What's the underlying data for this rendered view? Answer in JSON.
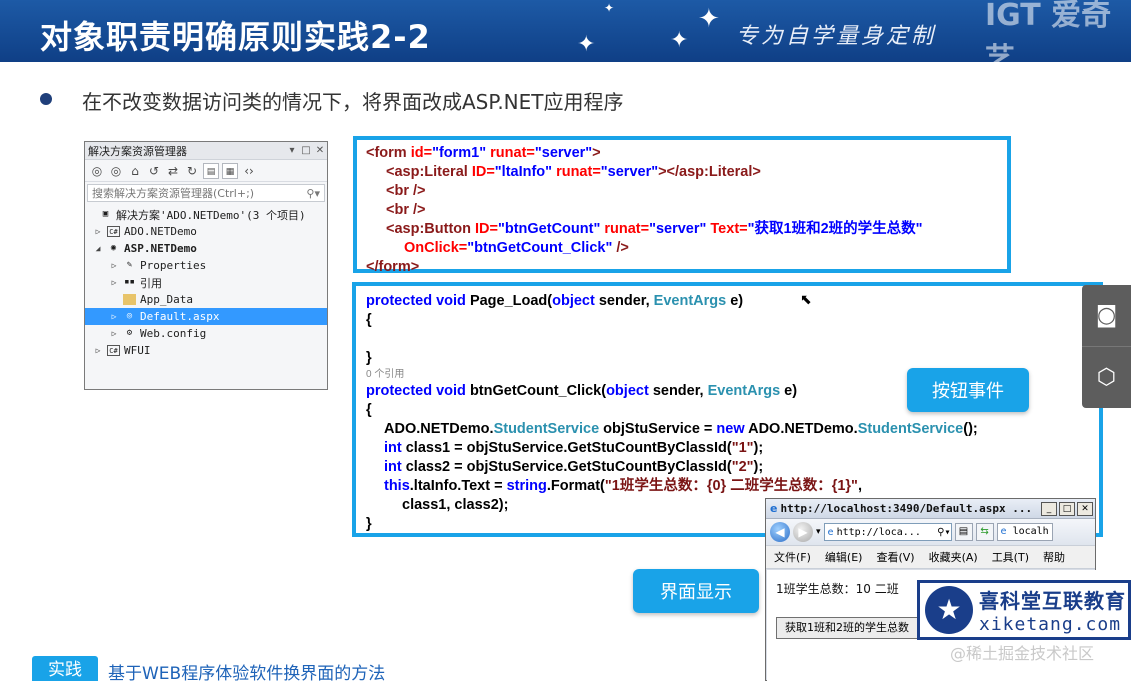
{
  "header": {
    "title": "对象职责明确原则实践2-2",
    "slogan": "专为自学量身定制",
    "brand_partial": "IGT 爱奇艺"
  },
  "bullet": "在不改变数据访问类的情况下，将界面改成ASP.NET应用程序",
  "solution_explorer": {
    "title": "解决方案资源管理器",
    "title_controls": [
      "▾",
      "□",
      "✕"
    ],
    "search_placeholder": "搜索解决方案资源管理器(Ctrl+;)",
    "tree": [
      {
        "label": "解决方案'ADO.NETDemo'(3 个项目)",
        "arrow": "",
        "icon": "solution-icon",
        "indent": 0
      },
      {
        "label": "ADO.NETDemo",
        "arrow": "▷",
        "icon": "csharp-project-icon",
        "indent": 0
      },
      {
        "label": "ASP.NETDemo",
        "arrow": "◢",
        "icon": "web-project-icon",
        "indent": 0
      },
      {
        "label": "Properties",
        "arrow": "▷",
        "icon": "wrench-icon",
        "indent": 1
      },
      {
        "label": "引用",
        "arrow": "▷",
        "icon": "references-icon",
        "indent": 1
      },
      {
        "label": "App_Data",
        "arrow": "",
        "icon": "folder-icon",
        "indent": 1
      },
      {
        "label": "Default.aspx",
        "arrow": "▷",
        "icon": "aspx-file-icon",
        "indent": 1,
        "selected": true
      },
      {
        "label": "Web.config",
        "arrow": "▷",
        "icon": "config-file-icon",
        "indent": 1
      },
      {
        "label": "WFUI",
        "arrow": "▷",
        "icon": "csharp-project-icon",
        "indent": 0
      }
    ]
  },
  "code_markup": {
    "l1": {
      "a": "<form ",
      "b": "id=",
      "c": "\"form1\" ",
      "d": "runat=",
      "e": "\"server\"",
      "f": ">"
    },
    "l2": {
      "a": "<asp:Literal ",
      "b": "ID=",
      "c": "\"ltaInfo\" ",
      "d": "runat=",
      "e": "\"server\"",
      "f": "></asp:Literal>"
    },
    "l3": {
      "a": "<br />"
    },
    "l4": {
      "a": "<br />"
    },
    "l5": {
      "a": "<asp:Button ",
      "b": "ID=",
      "c": "\"btnGetCount\" ",
      "d": "runat=",
      "e": "\"server\" ",
      "g": "Text=",
      "h": "\"获取1班和2班的学生总数\""
    },
    "l6": {
      "a": "OnClick=",
      "b": "\"btnGetCount_Click\"",
      "c": " />"
    },
    "l7": {
      "a": "</form>"
    }
  },
  "code_behind": {
    "l1": {
      "kw": "protected void ",
      "name": "Page_Load(",
      "kw2": "object ",
      "p": "sender, ",
      "ty": "EventArgs",
      "e": " e)"
    },
    "l2": "{",
    "l3": "}",
    "ref": "0 个引用",
    "l4": {
      "kw": "protected void ",
      "name": "btnGetCount_Click(",
      "kw2": "object ",
      "p": "sender, ",
      "ty": "EventArgs",
      "e": " e)"
    },
    "l5": "{",
    "l6": {
      "a": "ADO.NETDemo.",
      "ty": "StudentService",
      "b": " objStuService = ",
      "kw": "new",
      "c": " ADO.NETDemo.",
      "ty2": "StudentService",
      "d": "();"
    },
    "l7": {
      "kw": "int",
      "a": " class1 = objStuService.GetStuCountByClassId(",
      "s": "\"1\"",
      "b": ");"
    },
    "l8": {
      "kw": "int",
      "a": " class2 = objStuService.GetStuCountByClassId(",
      "s": "\"2\"",
      "b": ");"
    },
    "l9": {
      "kw": "this",
      "a": ".ltaInfo.Text = ",
      "kw2": "string",
      "b": ".Format(",
      "s": "\"1班学生总数：{0} 二班学生总数：{1}\"",
      "c": ","
    },
    "l10": "class1, class2);",
    "l11": "}"
  },
  "callouts": {
    "button_event": "按钮事件",
    "ui_display": "界面显示"
  },
  "ie_window": {
    "title": "http://localhost:3490/Default.aspx ...",
    "address": "http://loca...",
    "tab": "localh",
    "menu": [
      "文件(F)",
      "编辑(E)",
      "查看(V)",
      "收藏夹(A)",
      "工具(T)",
      "帮助"
    ],
    "info_text": "1班学生总数：10 二班",
    "page_button": "获取1班和2班的学生总数"
  },
  "watermark": {
    "cn": "喜科堂互联教育",
    "en": "xiketang.com",
    "juejin": "@稀土掘金技术社区"
  },
  "practice": {
    "tag": "实践",
    "text": "基于WEB程序体验软件换界面的方法"
  }
}
